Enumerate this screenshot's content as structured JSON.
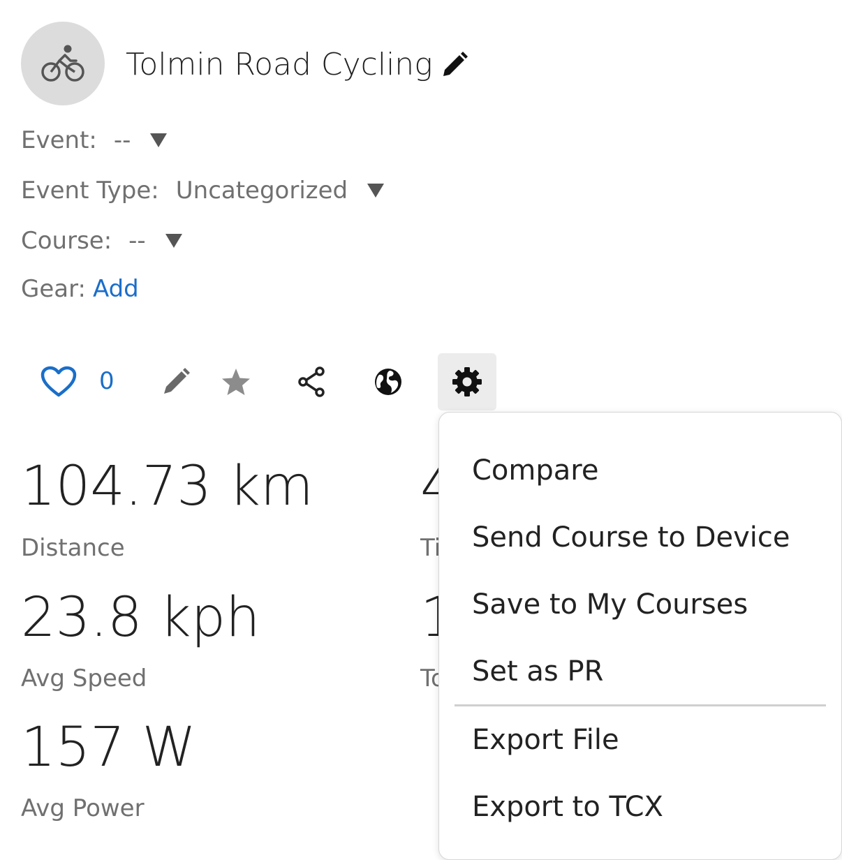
{
  "header": {
    "title": "Tolmin Road Cycling",
    "avatar_icon": "cycling-icon",
    "edit_icon": "pencil-icon"
  },
  "meta": {
    "event_label": "Event:",
    "event_value": "--",
    "event_type_label": "Event Type:",
    "event_type_value": "Uncategorized",
    "course_label": "Course:",
    "course_value": "--",
    "gear_label": "Gear:",
    "gear_link": "Add"
  },
  "toolbar": {
    "like_icon": "heart-icon",
    "like_count": "0",
    "edit_icon": "pencil-icon",
    "favorite_icon": "star-icon",
    "share_icon": "share-icon",
    "privacy_icon": "globe-icon",
    "settings_icon": "gear-icon"
  },
  "stats": [
    {
      "value": "104.73 km",
      "label": "Distance"
    },
    {
      "value": "23.8 kph",
      "label": "Avg Speed"
    },
    {
      "value": "157 W",
      "label": "Avg Power"
    }
  ],
  "stats_col2_partial": [
    {
      "value": "4",
      "label": "Ti"
    },
    {
      "value": "1",
      "label": "To"
    }
  ],
  "menu": {
    "items": [
      "Compare",
      "Send Course to Device",
      "Save to My Courses",
      "Set as PR"
    ],
    "items_after_divider": [
      "Export File",
      "Export to TCX"
    ]
  },
  "colors": {
    "accent": "#1a6ec9",
    "muted_text": "#707070",
    "avatar_bg": "#dcdcdc"
  }
}
